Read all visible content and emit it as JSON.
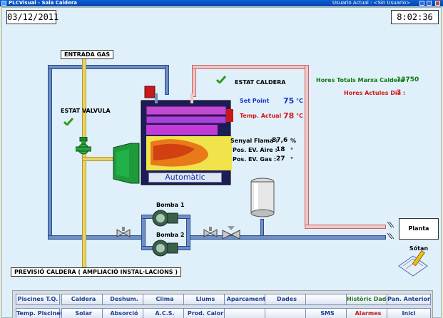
{
  "window": {
    "title": "PLCVisual - Sala Caldera",
    "user": "Usuario Actual : <Sin Usuario>"
  },
  "header": {
    "date": "03/12/2011",
    "time": "8:02:36"
  },
  "labels": {
    "entrada_gas": "ENTRADA GAS",
    "estat_valvula": "ESTAT VALVULA",
    "estat_caldera": "ESTAT CALDERA",
    "previsio": "PREVISIÓ CALDERA ( AMPLIACIÓ INSTAL·LACIONS )",
    "planta_sotan": "Planta Sótan",
    "bomba1": "Bomba 1",
    "bomba2": "Bomba 2",
    "automatic": "Automàtic"
  },
  "status": {
    "setpoint_label": "Set Point",
    "setpoint_value": "75",
    "setpoint_unit": "°C",
    "temp_label": "Temp. Actual",
    "temp_value": "78",
    "temp_unit": "°C",
    "hores_totals_label": "Hores Totals Marxa Caldera :",
    "hores_totals_value": "13750",
    "hores_dia_label": "Hores Actules Dia :",
    "hores_dia_value": "3",
    "senyal_flama_label": "Senyal Flama :",
    "senyal_flama_value": "87,6",
    "senyal_flama_unit": "%",
    "pos_aire_label": "Pos. EV. Aire :",
    "pos_aire_value": "18",
    "pos_aire_unit": "°",
    "pos_gas_label": "Pos. EV. Gas :",
    "pos_gas_value": "27",
    "pos_gas_unit": "°"
  },
  "buttons": {
    "row1": [
      "Piscines T.Q.",
      "Caldera",
      "Deshum.",
      "Clima",
      "Llums",
      "Aparcament",
      "Dades",
      "",
      "Històric Dades",
      "Pan. Anterior"
    ],
    "row2": [
      "Temp. Piscines",
      "Solar",
      "Absorció",
      "A.C.S.",
      "Prod. Calor",
      "",
      "",
      "SMS",
      "Alarmes",
      "Inici"
    ]
  },
  "colors": {
    "blue_value": "#1632c4",
    "red_value": "#d21818",
    "green_value": "#117a11",
    "hot_pipe": "#f2c7c7",
    "return_pipe": "#6d8fc6",
    "gas_pipe": "#e9d36b"
  }
}
